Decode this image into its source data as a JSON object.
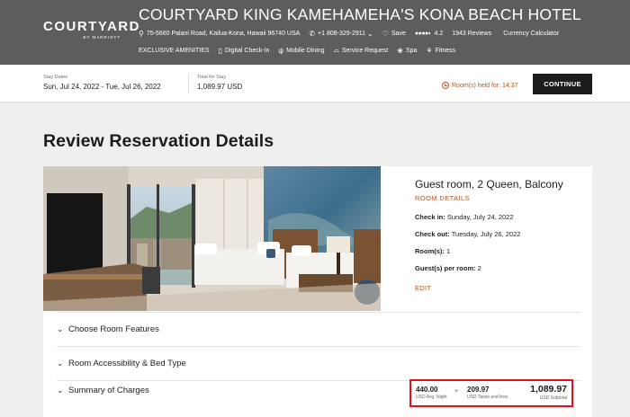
{
  "header": {
    "logo_main": "COURTYARD",
    "logo_sub": "BY MARRIOTT",
    "hotel_name": "COURTYARD KING KAMEHAMEHA'S KONA BEACH HOTEL",
    "address": "75-5660 Palani Road, Kailua-Kona, Hawaii 96740 USA",
    "phone": "+1 808-329-2911",
    "save_label": "Save",
    "rating": "4.2",
    "reviews": "1943 Reviews",
    "currency_calculator": "Currency Calculator",
    "amenities": [
      {
        "label": "EXCLUSIVE AMENITIES",
        "icon": "none"
      },
      {
        "label": "Digital Check-In",
        "icon": "phone-icon"
      },
      {
        "label": "Mobile Dining",
        "icon": "dining-icon"
      },
      {
        "label": "Service Request",
        "icon": "bell-icon"
      },
      {
        "label": "Spa",
        "icon": "spa-icon"
      },
      {
        "label": "Fitness",
        "icon": "fitness-icon"
      }
    ]
  },
  "stay": {
    "dates_label": "Stay Dates",
    "dates_value": "Sun, Jul 24, 2022 - Tue, Jul 26, 2022",
    "total_label": "Total for Stay",
    "total_value": "1,089.97 USD",
    "held_text": "Room(s) held for: 14:37",
    "continue_label": "CONTINUE"
  },
  "main": {
    "title": "Review Reservation Details",
    "room": {
      "name": "Guest room, 2 Queen, Balcony",
      "details_link": "ROOM DETAILS",
      "checkin_label": "Check in:",
      "checkin_value": "Sunday, July 24, 2022",
      "checkout_label": "Check out:",
      "checkout_value": "Tuesday, July 26, 2022",
      "rooms_label": "Room(s):",
      "rooms_value": "1",
      "guests_label": "Guest(s) per room:",
      "guests_value": "2",
      "edit_label": "EDIT"
    },
    "accordions": [
      {
        "label": "Choose Room Features"
      },
      {
        "label": "Room Accessibility & Bed Type"
      },
      {
        "label": "Summary of Charges"
      }
    ],
    "charges": {
      "avg_value": "440.00",
      "avg_label": "USD Avg. Night",
      "plus": "+",
      "taxes_value": "209.97",
      "taxes_label": "USD Taxes and fees",
      "subtotal_value": "1,089.97",
      "subtotal_label": "USD Subtotal"
    }
  },
  "colors": {
    "header_bg": "#5d5d5d",
    "accent": "#b4531f",
    "highlight_border": "#e0101f",
    "button_bg": "#1c1c1c"
  }
}
